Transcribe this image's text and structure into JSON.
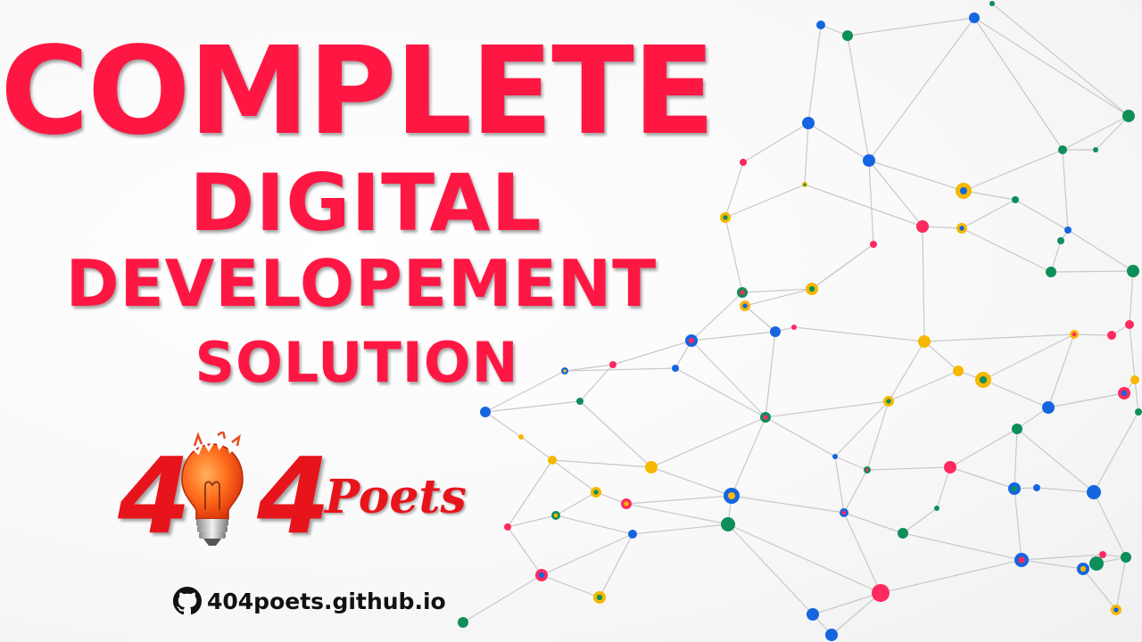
{
  "headline": {
    "line1": "COMPLETE",
    "line2": "DIGITAL",
    "line3": "DEVELOPEMENT",
    "line4": "SOLUTION"
  },
  "logo": {
    "digit_left": "4",
    "digit_right": "4",
    "word": "Poets",
    "icon": "lightbulb-icon"
  },
  "website": {
    "icon": "github-icon",
    "url_text": "404poets.github.io"
  },
  "colors": {
    "brand_red": "#ff1744",
    "logo_red": "#e8141c",
    "dark_text": "#111111",
    "node_blue": "#1565e0",
    "node_green": "#0e8f5a",
    "node_yellow": "#f6b800",
    "node_pink": "#ff2a5f",
    "link_gray": "#c8c8c8"
  }
}
